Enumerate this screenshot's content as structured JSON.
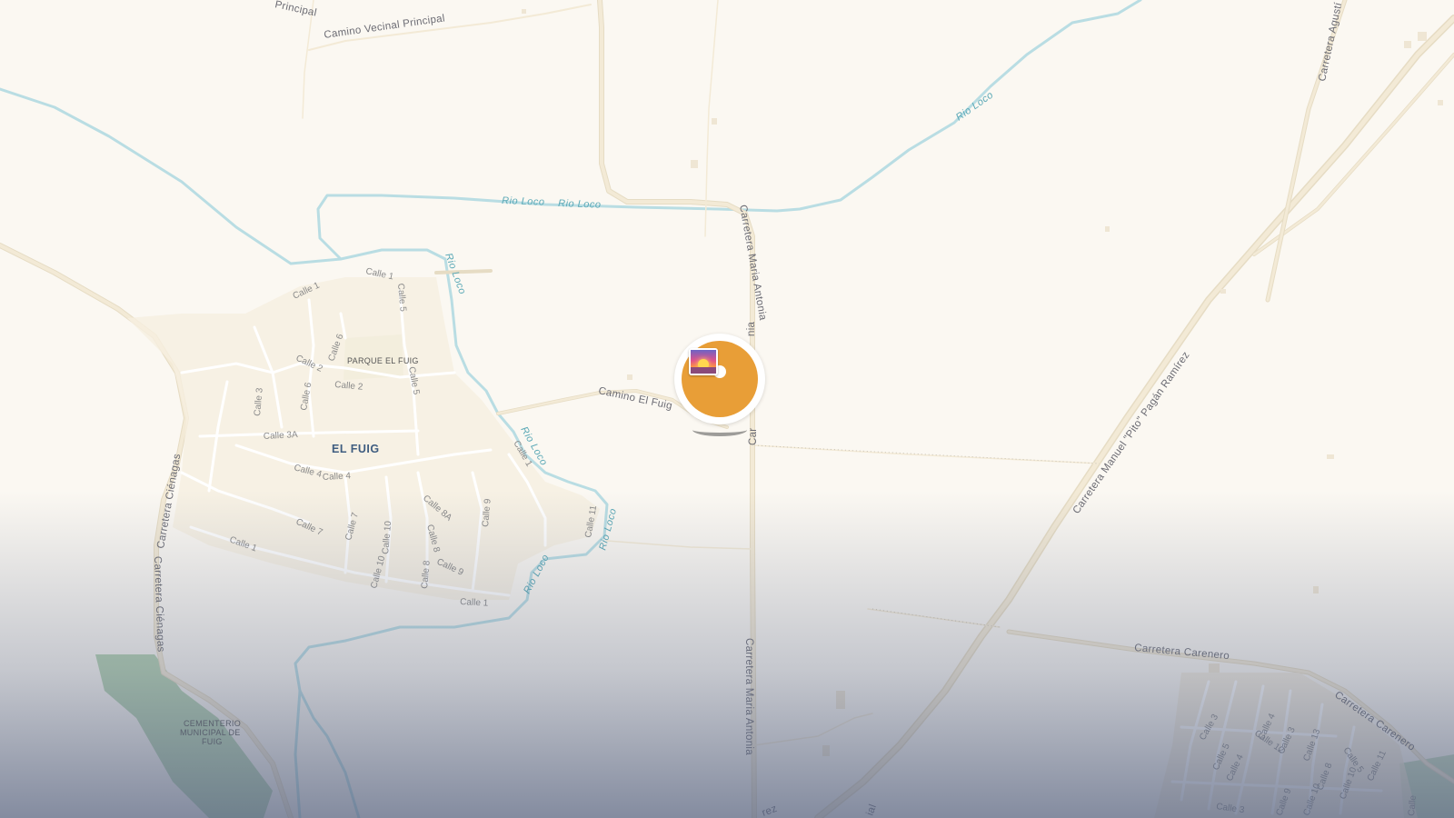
{
  "map": {
    "town_label": "EL FUIG",
    "park_label": "PARQUE EL FUIG",
    "cemetery_label_lines": [
      "CEMENTERIO",
      "MUNICIPAL DE",
      "FUIG"
    ],
    "roads": {
      "camino_vecinal_top": "Principal",
      "camino_vecinal": "Camino Vecinal Principal",
      "maria_antonia_top": "Carretera Maria Antonia",
      "maria_antonia_mid": "nia",
      "maria_antonia_marker": "Car",
      "maria_antonia_bottom": "Carretera Maria Antonia",
      "camino_el_fuig": "Camino El Fuig",
      "pito_pagan": "Carretera Manuel \"Pito\" Pagán Ramírez",
      "agustin": "Carretera Agustí",
      "carenero_h": "Carretera Carenero",
      "carenero_diag": "Carretera Carenero",
      "cienagas_upper": "Carretera Ciénagas",
      "cienagas_lower": "Carretera Ciénagas",
      "bottom_rez": "rez",
      "bottom_ial": "ial"
    },
    "rivers": {
      "r1": "Rio Loco",
      "r2": "Rio Loco",
      "r3": "Rio Loco",
      "r4": "Rio Loco",
      "r5": "Rio Loco",
      "r6": "Rio Loco",
      "r7": "Rio Loco"
    },
    "streets": {
      "s_calle1_a": "Calle 1",
      "s_calle1_b": "Calle 1",
      "s_calle1_c": "Calle 1",
      "s_calle1_d": "Calle 1",
      "s_calle1_e": "Calle 1",
      "s_calle2_a": "Calle 2",
      "s_calle2_b": "Calle 2",
      "s_calle3": "Calle 3",
      "s_calle3a": "Calle 3A",
      "s_calle4_a": "Calle 4",
      "s_calle4_b": "Calle 4",
      "s_calle5_a": "Calle 5",
      "s_calle5_b": "Calle 5",
      "s_calle6_a": "Calle 6",
      "s_calle6_b": "Calle 6",
      "s_calle7_a": "Calle 7",
      "s_calle7_b": "Calle 7",
      "s_calle8": "Calle 8",
      "s_calle8a": "Calle 8A",
      "s_calle9_a": "Calle 9",
      "s_calle9_b": "Calle 9",
      "s_calle10_a": "Calle 10",
      "s_calle10_b": "Calle 10",
      "s_calle11": "Calle 11",
      "s_se_3": "Calle 3",
      "s_se_5": "Calle 5",
      "s_se_4": "Calle 4",
      "s_se_4b": "Calle 4",
      "s_se_13": "Calle 13",
      "s_se_3b": "Calle 3",
      "s_se_8": "Calle 8",
      "s_se_10": "Calle 10",
      "s_se_11": "Calle 11",
      "s_se_9": "Calle 9",
      "s_se_12": "Calle 12",
      "s_se_10b": "Calle 10",
      "s_se_5b": "Calle 5",
      "s_se_3c": "Calle 3",
      "s_se_1": "Calle"
    },
    "colors": {
      "land": "#fbf8f2",
      "road": "#f3ead6",
      "river": "#b9dde3",
      "park": "#e4ecd2",
      "cemetery": "#9cc59a",
      "marker": "#e89e37",
      "fade": "#606c8a"
    }
  },
  "marker": {
    "icon": "sunset-photo-icon",
    "color": "#e89e37"
  }
}
